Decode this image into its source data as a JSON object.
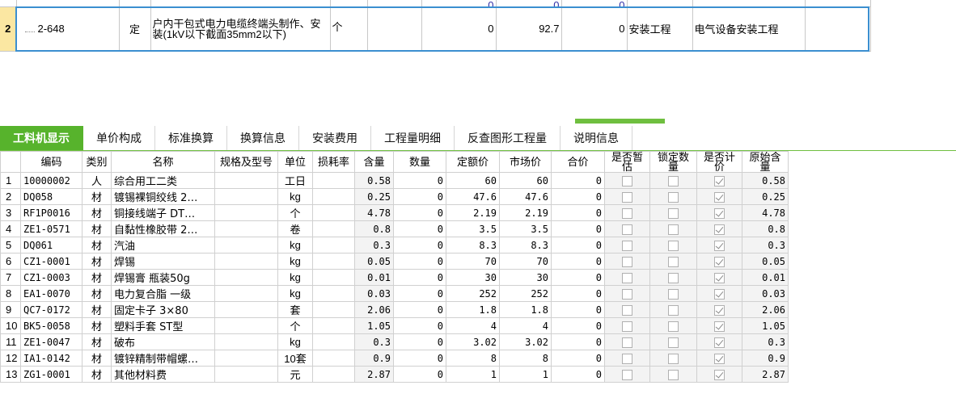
{
  "upper": {
    "cut_row": [
      "",
      "",
      "",
      "",
      "",
      "",
      "0",
      "0",
      "0",
      "",
      ""
    ],
    "selected_row": {
      "row_no": "2",
      "code": "2-648",
      "type": "定",
      "name": "户内干包式电力电缆终端头制作、安装(1kV以下截面35mm2以下)",
      "unit": "个",
      "quantity_expr": "",
      "quantity": "0",
      "unit_price": "92.7",
      "total": "0",
      "project_type": "安装工程",
      "specialty": "电气设备安装工程",
      "extra": ""
    }
  },
  "tabs": [
    {
      "label": "工料机显示",
      "active": true
    },
    {
      "label": "单价构成",
      "active": false
    },
    {
      "label": "标准换算",
      "active": false
    },
    {
      "label": "换算信息",
      "active": false
    },
    {
      "label": "安装费用",
      "active": false
    },
    {
      "label": "工程量明细",
      "active": false
    },
    {
      "label": "反查图形工程量",
      "active": false
    },
    {
      "label": "说明信息",
      "active": false
    }
  ],
  "grid": {
    "headers": [
      "",
      "编码",
      "类别",
      "名称",
      "规格及型号",
      "单位",
      "损耗率",
      "含量",
      "数量",
      "定额价",
      "市场价",
      "合价",
      "是否暂估",
      "锁定数量",
      "是否计价",
      "原始含量"
    ],
    "rows": [
      {
        "no": "1",
        "code": "10000002",
        "cat": "人",
        "name": "综合用工二类",
        "spec": "",
        "unit": "工日",
        "loss": "",
        "content": "0.58",
        "qty": "0",
        "quota": "60",
        "market": "60",
        "total": "0",
        "est": false,
        "lock": false,
        "priced": true,
        "orig": "0.58"
      },
      {
        "no": "2",
        "code": "DQ058",
        "cat": "材",
        "name": "镀锡裸铜绞线 2…",
        "spec": "",
        "unit": "kg",
        "loss": "",
        "content": "0.25",
        "qty": "0",
        "quota": "47.6",
        "market": "47.6",
        "total": "0",
        "est": false,
        "lock": false,
        "priced": true,
        "orig": "0.25"
      },
      {
        "no": "3",
        "code": "RF1P0016",
        "cat": "材",
        "name": "铜接线端子 DT…",
        "spec": "",
        "unit": "个",
        "loss": "",
        "content": "4.78",
        "qty": "0",
        "quota": "2.19",
        "market": "2.19",
        "total": "0",
        "est": false,
        "lock": false,
        "priced": true,
        "orig": "4.78"
      },
      {
        "no": "4",
        "code": "ZE1-0571",
        "cat": "材",
        "name": "自黏性橡胶带 2…",
        "spec": "",
        "unit": "卷",
        "loss": "",
        "content": "0.8",
        "qty": "0",
        "quota": "3.5",
        "market": "3.5",
        "total": "0",
        "est": false,
        "lock": false,
        "priced": true,
        "orig": "0.8"
      },
      {
        "no": "5",
        "code": "DQ061",
        "cat": "材",
        "name": "汽油",
        "spec": "",
        "unit": "kg",
        "loss": "",
        "content": "0.3",
        "qty": "0",
        "quota": "8.3",
        "market": "8.3",
        "total": "0",
        "est": false,
        "lock": false,
        "priced": true,
        "orig": "0.3"
      },
      {
        "no": "6",
        "code": "CZ1-0001",
        "cat": "材",
        "name": "焊锡",
        "spec": "",
        "unit": "kg",
        "loss": "",
        "content": "0.05",
        "qty": "0",
        "quota": "70",
        "market": "70",
        "total": "0",
        "est": false,
        "lock": false,
        "priced": true,
        "orig": "0.05"
      },
      {
        "no": "7",
        "code": "CZ1-0003",
        "cat": "材",
        "name": "焊锡膏 瓶装50g",
        "spec": "",
        "unit": "kg",
        "loss": "",
        "content": "0.01",
        "qty": "0",
        "quota": "30",
        "market": "30",
        "total": "0",
        "est": false,
        "lock": false,
        "priced": true,
        "orig": "0.01"
      },
      {
        "no": "8",
        "code": "EA1-0070",
        "cat": "材",
        "name": "电力复合脂 一级",
        "spec": "",
        "unit": "kg",
        "loss": "",
        "content": "0.03",
        "qty": "0",
        "quota": "252",
        "market": "252",
        "total": "0",
        "est": false,
        "lock": false,
        "priced": true,
        "orig": "0.03"
      },
      {
        "no": "9",
        "code": "QC7-0172",
        "cat": "材",
        "name": "固定卡子 3×80",
        "spec": "",
        "unit": "套",
        "loss": "",
        "content": "2.06",
        "qty": "0",
        "quota": "1.8",
        "market": "1.8",
        "total": "0",
        "est": false,
        "lock": false,
        "priced": true,
        "orig": "2.06"
      },
      {
        "no": "10",
        "code": "BK5-0058",
        "cat": "材",
        "name": "塑料手套 ST型",
        "spec": "",
        "unit": "个",
        "loss": "",
        "content": "1.05",
        "qty": "0",
        "quota": "4",
        "market": "4",
        "total": "0",
        "est": false,
        "lock": false,
        "priced": true,
        "orig": "1.05"
      },
      {
        "no": "11",
        "code": "ZE1-0047",
        "cat": "材",
        "name": "破布",
        "spec": "",
        "unit": "kg",
        "loss": "",
        "content": "0.3",
        "qty": "0",
        "quota": "3.02",
        "market": "3.02",
        "total": "0",
        "est": false,
        "lock": false,
        "priced": true,
        "orig": "0.3"
      },
      {
        "no": "12",
        "code": "IA1-0142",
        "cat": "材",
        "name": "镀锌精制带帽螺…",
        "spec": "",
        "unit": "10套",
        "loss": "",
        "content": "0.9",
        "qty": "0",
        "quota": "8",
        "market": "8",
        "total": "0",
        "est": false,
        "lock": false,
        "priced": true,
        "orig": "0.9"
      },
      {
        "no": "13",
        "code": "ZG1-0001",
        "cat": "材",
        "name": "其他材料费",
        "spec": "",
        "unit": "元",
        "loss": "",
        "content": "2.87",
        "qty": "0",
        "quota": "1",
        "market": "1",
        "total": "0",
        "est": false,
        "lock": false,
        "priced": true,
        "orig": "2.87"
      }
    ]
  },
  "colors": {
    "accent_green": "#57b32c",
    "selection_blue": "#3b8fd0",
    "row_header_yellow": "#fbe7a2"
  }
}
